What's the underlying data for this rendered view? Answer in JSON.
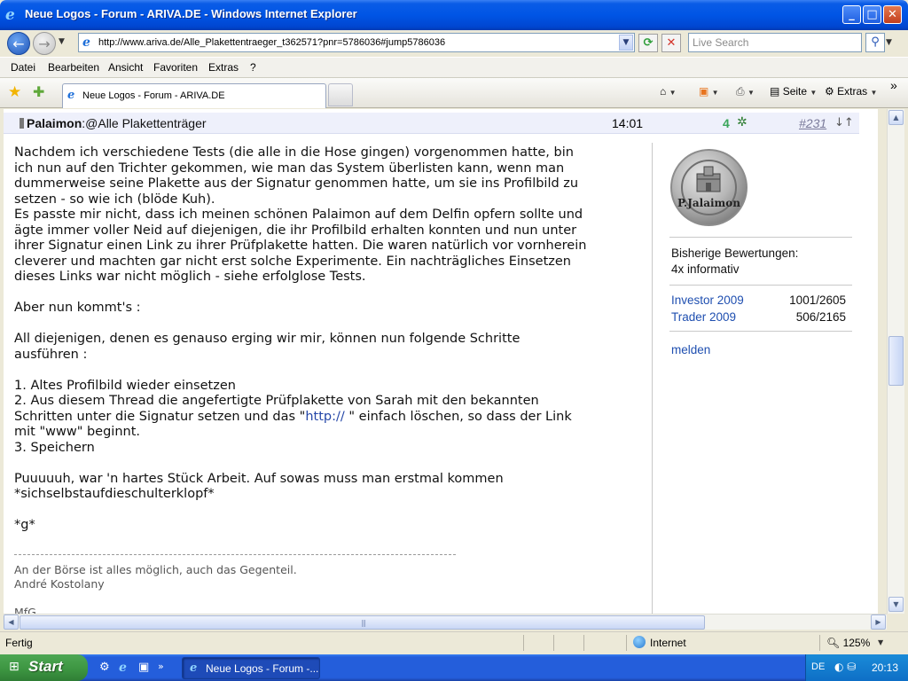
{
  "window": {
    "title": "Neue Logos - Forum - ARIVA.DE - Windows Internet Explorer"
  },
  "address_bar": {
    "url": "http://www.ariva.de/Alle_Plakettentraeger_t362571?pnr=5786036#jump5786036",
    "search_placeholder": "Live Search"
  },
  "menu": [
    "Datei",
    "Bearbeiten",
    "Ansicht",
    "Favoriten",
    "Extras",
    "?"
  ],
  "tab": {
    "label": "Neue Logos - Forum - ARIVA.DE"
  },
  "commands": {
    "page": "Seite",
    "tools": "Extras",
    "more": "»"
  },
  "post": {
    "author": "Palaimon",
    "subject": ":@Alle Plakettenträger",
    "time": "14:01",
    "rating": "4",
    "number": "#231",
    "arrows": "↓↑",
    "body": {
      "p1": [
        "Nachdem ich verschiedene Tests (die alle in die Hose gingen) vorgenommen hatte, bin",
        "ich nun auf den Trichter gekommen, wie man das System überlisten kann, wenn man",
        "dummerweise seine Plakette aus der Signatur genommen hatte, um sie ins Profilbild zu",
        "setzen - so wie ich (blöde Kuh).",
        "Es passte mir nicht, dass ich meinen schönen Palaimon auf dem Delfin opfern sollte und",
        "ägte immer voller Neid auf diejenigen, die ihr Profilbild erhalten konnten und nun unter",
        "ihrer Signatur einen Link zu ihrer Prüfplakette hatten. Die waren natürlich vor vornherein",
        "cleverer und machten gar nicht erst solche Experimente. Ein nachträgliches Einsetzen",
        "dieses Links war nicht möglich - siehe erfolglose Tests."
      ],
      "p2": "Aber nun kommt's :",
      "p3": [
        "All diejenigen, denen es genauso erging wir mir, können nun folgende Schritte",
        "ausführen :"
      ],
      "step1": "1. Altes Profilbild wieder einsetzen",
      "step2a": "2. Aus diesem Thread die angefertigte Prüfplakette von Sarah mit den bekannten",
      "step2b_pre": "Schritten unter die Signatur setzen und das \"",
      "step2b_link": "http://",
      "step2b_post": " \" einfach löschen, so dass der Link",
      "step2c": "mit \"www\" beginnt.",
      "step3": "3. Speichern",
      "p4": [
        "Puuuuuh, war 'n hartes Stück Arbeit. Auf sowas muss man erstmal kommen",
        "*sichselbstaufdieschulterklopf*"
      ],
      "p5": "*g*"
    },
    "signature": {
      "line1": "An der Börse ist alles möglich, auch das Gegenteil.",
      "line2": "André Kostolany",
      "line3": "MfG"
    }
  },
  "profile": {
    "avatar_text": "P.Jalaimon",
    "ratings_label": "Bisherige Bewertungen:",
    "ratings_value": "4x informativ",
    "stats": [
      {
        "name": "Investor 2009",
        "value": "1001/2605"
      },
      {
        "name": "Trader 2009",
        "value": "506/2165"
      }
    ],
    "report": "melden"
  },
  "status": {
    "text": "Fertig",
    "zone": "Internet",
    "zoom": "125%"
  },
  "taskbar": {
    "start": "Start",
    "window_label": "Neue Logos - Forum -...",
    "lang": "DE",
    "clock": "20:13"
  },
  "colors": {
    "accent": "#245edb",
    "link": "#1f4fb0",
    "rating_green": "#3aa55a"
  }
}
